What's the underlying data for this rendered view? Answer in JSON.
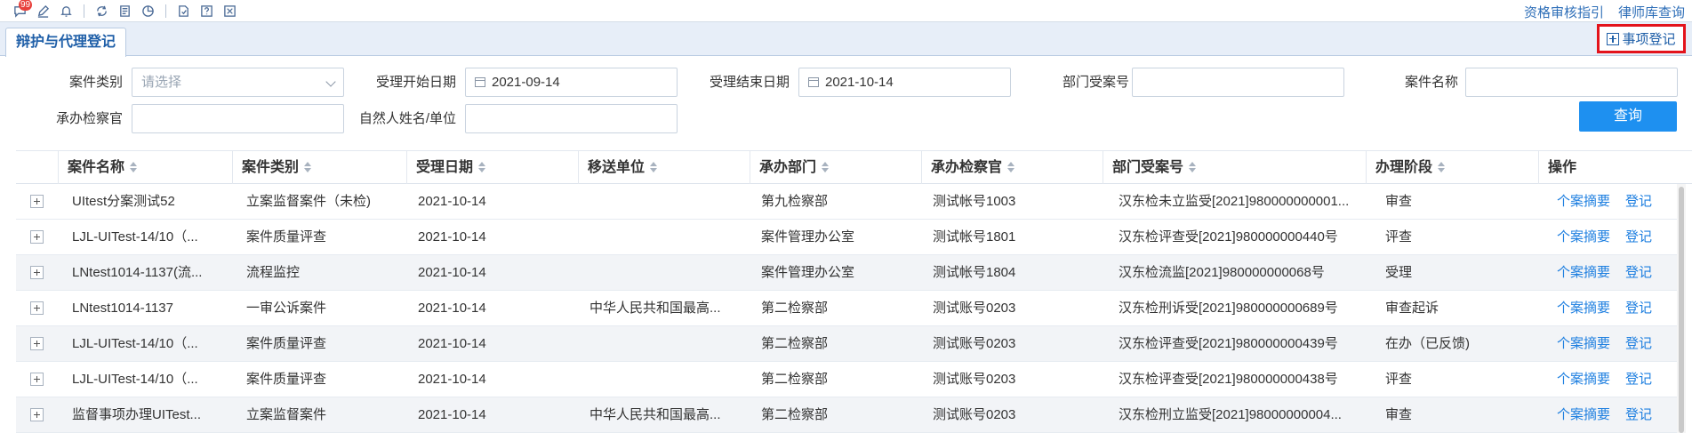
{
  "toolbar": {
    "badge_count": "99",
    "icons": [
      "message-icon",
      "edit-icon",
      "bell-icon",
      "sync-icon",
      "document-icon",
      "chart-icon",
      "report-icon",
      "help-icon",
      "fullscreen-icon"
    ],
    "links": [
      "资格审核指引",
      "律师库查询"
    ]
  },
  "tabs": {
    "active": "辩护与代理登记"
  },
  "actions": {
    "register": "事项登记"
  },
  "filters": {
    "case_type_label": "案件类别",
    "case_type_placeholder": "请选择",
    "start_date_label": "受理开始日期",
    "start_date": "2021-09-14",
    "end_date_label": "受理结束日期",
    "end_date": "2021-10-14",
    "dept_case_no_label": "部门受案号",
    "case_name_label": "案件名称",
    "prosecutor_label": "承办检察官",
    "person_label": "自然人姓名/单位",
    "query": "查询"
  },
  "table": {
    "columns": [
      "案件名称",
      "案件类别",
      "受理日期",
      "移送单位",
      "承办部门",
      "承办检察官",
      "部门受案号",
      "办理阶段",
      "操作"
    ],
    "op_summary": "个案摘要",
    "op_register": "登记",
    "rows": [
      {
        "name": "UItest分案测试52",
        "type": "立案监督案件（未检)",
        "date": "2021-10-14",
        "unit": "",
        "dept": "第九检察部",
        "officer": "测试帐号1003",
        "case_no": "汉东检未立监受[2021]980000000001...",
        "stage": "审查"
      },
      {
        "name": "LJL-UITest-14/10（...",
        "type": "案件质量评查",
        "date": "2021-10-14",
        "unit": "",
        "dept": "案件管理办公室",
        "officer": "测试帐号1801",
        "case_no": "汉东检评查受[2021]980000000440号",
        "stage": "评查"
      },
      {
        "name": "LNtest1014-1137(流...",
        "type": "流程监控",
        "date": "2021-10-14",
        "unit": "",
        "dept": "案件管理办公室",
        "officer": "测试帐号1804",
        "case_no": "汉东检流监[2021]980000000068号",
        "stage": "受理"
      },
      {
        "name": "LNtest1014-1137",
        "type": "一审公诉案件",
        "date": "2021-10-14",
        "unit": "中华人民共和国最高...",
        "dept": "第二检察部",
        "officer": "测试账号0203",
        "case_no": "汉东检刑诉受[2021]980000000689号",
        "stage": "审查起诉"
      },
      {
        "name": "LJL-UITest-14/10（...",
        "type": "案件质量评查",
        "date": "2021-10-14",
        "unit": "",
        "dept": "第二检察部",
        "officer": "测试账号0203",
        "case_no": "汉东检评查受[2021]980000000439号",
        "stage": "在办（已反馈)"
      },
      {
        "name": "LJL-UITest-14/10（...",
        "type": "案件质量评查",
        "date": "2021-10-14",
        "unit": "",
        "dept": "第二检察部",
        "officer": "测试账号0203",
        "case_no": "汉东检评查受[2021]980000000438号",
        "stage": "评查"
      },
      {
        "name": "监督事项办理UITest...",
        "type": "立案监督案件",
        "date": "2021-10-14",
        "unit": "中华人民共和国最高...",
        "dept": "第二检察部",
        "officer": "测试账号0203",
        "case_no": "汉东检刑立监受[2021]98000000004...",
        "stage": "审查"
      }
    ]
  }
}
